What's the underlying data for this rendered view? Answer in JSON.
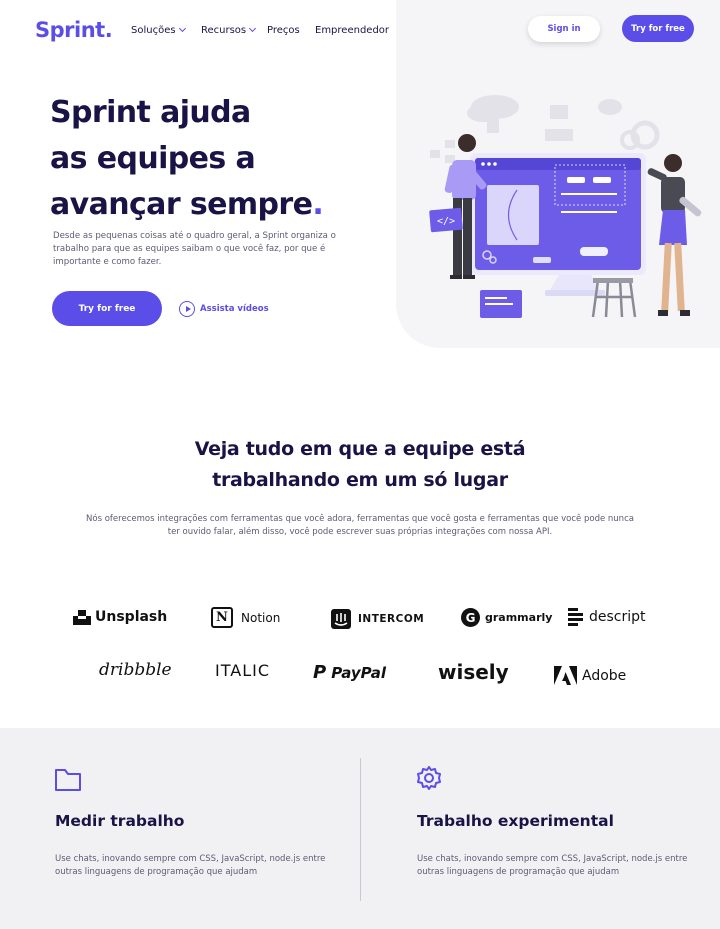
{
  "brand": {
    "name": "Sprint.",
    "accent": "#5b4de8",
    "dark": "#1a1446"
  },
  "nav": {
    "items": [
      {
        "label": "Soluções"
      },
      {
        "label": "Recursos"
      },
      {
        "label": "Preços"
      },
      {
        "label": "Empreendedor"
      }
    ],
    "signin_label": "Sign in",
    "try_label": "Try for free"
  },
  "hero": {
    "title_line1": "Sprint ajuda",
    "title_line2": "as equipes a",
    "title_line3": "avançar sempre",
    "title_dot": ".",
    "description": "Desde as pequenas coisas até o quadro geral, a Sprint organiza o trabalho para que as equipes saibam o que você faz, por que é importante e como fazer.",
    "cta_label": "Try for free",
    "watch_label": "Assista vídeos"
  },
  "integrations": {
    "title_line1": "Veja tudo em que a equipe está",
    "title_line2": "trabalhando em um só lugar",
    "description": "Nós oferecemos integrações com ferramentas que você adora, ferramentas que você gosta e ferramentas que você pode nunca ter ouvido falar, além disso, você pode escrever suas próprias integrações com nossa API.",
    "logos": [
      "Unsplash",
      "Notion",
      "INTERCOM",
      "grammarly",
      "descript",
      "dribbble",
      "ITALIC",
      "PayPal",
      "wisely",
      "Adobe"
    ]
  },
  "features": [
    {
      "icon": "folder-icon",
      "title": "Medir trabalho",
      "description": "Use chats, inovando sempre com CSS, JavaScript, node.js entre outras linguagens de programação que ajudam"
    },
    {
      "icon": "gear-icon",
      "title": "Trabalho experimental",
      "description": "Use chats, inovando sempre com CSS, JavaScript, node.js entre outras linguagens de programação que ajudam"
    }
  ]
}
